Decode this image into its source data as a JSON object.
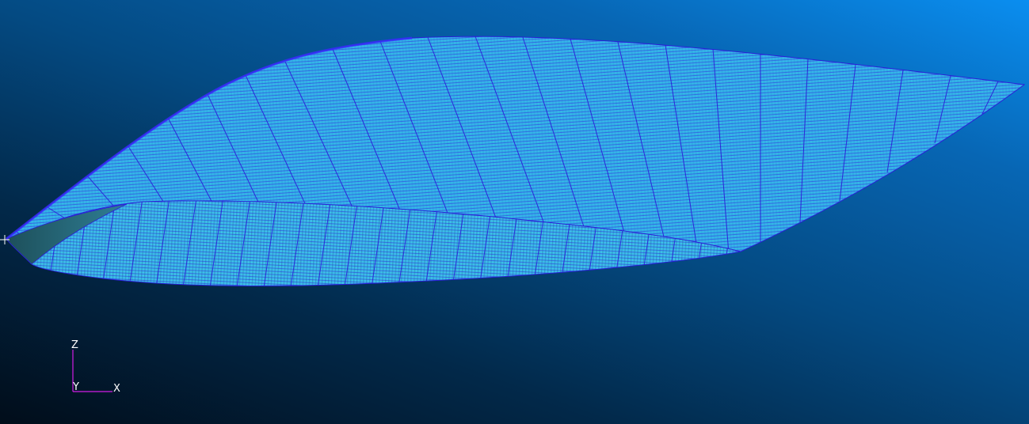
{
  "view": {
    "background_colors": [
      "#0a8ef0",
      "#044a82",
      "#010d1a"
    ],
    "mesh_fill_color": "#38b8e8",
    "mesh_line_color": "#2b1ed8",
    "mesh_highlight_color": "#7fe0ff"
  },
  "axis_triad": {
    "z_label": "Z",
    "y_label": "Y",
    "x_label": "X",
    "axis_color": "#d21ee6"
  },
  "markers": {
    "origin_icon": "crosshair-icon"
  }
}
